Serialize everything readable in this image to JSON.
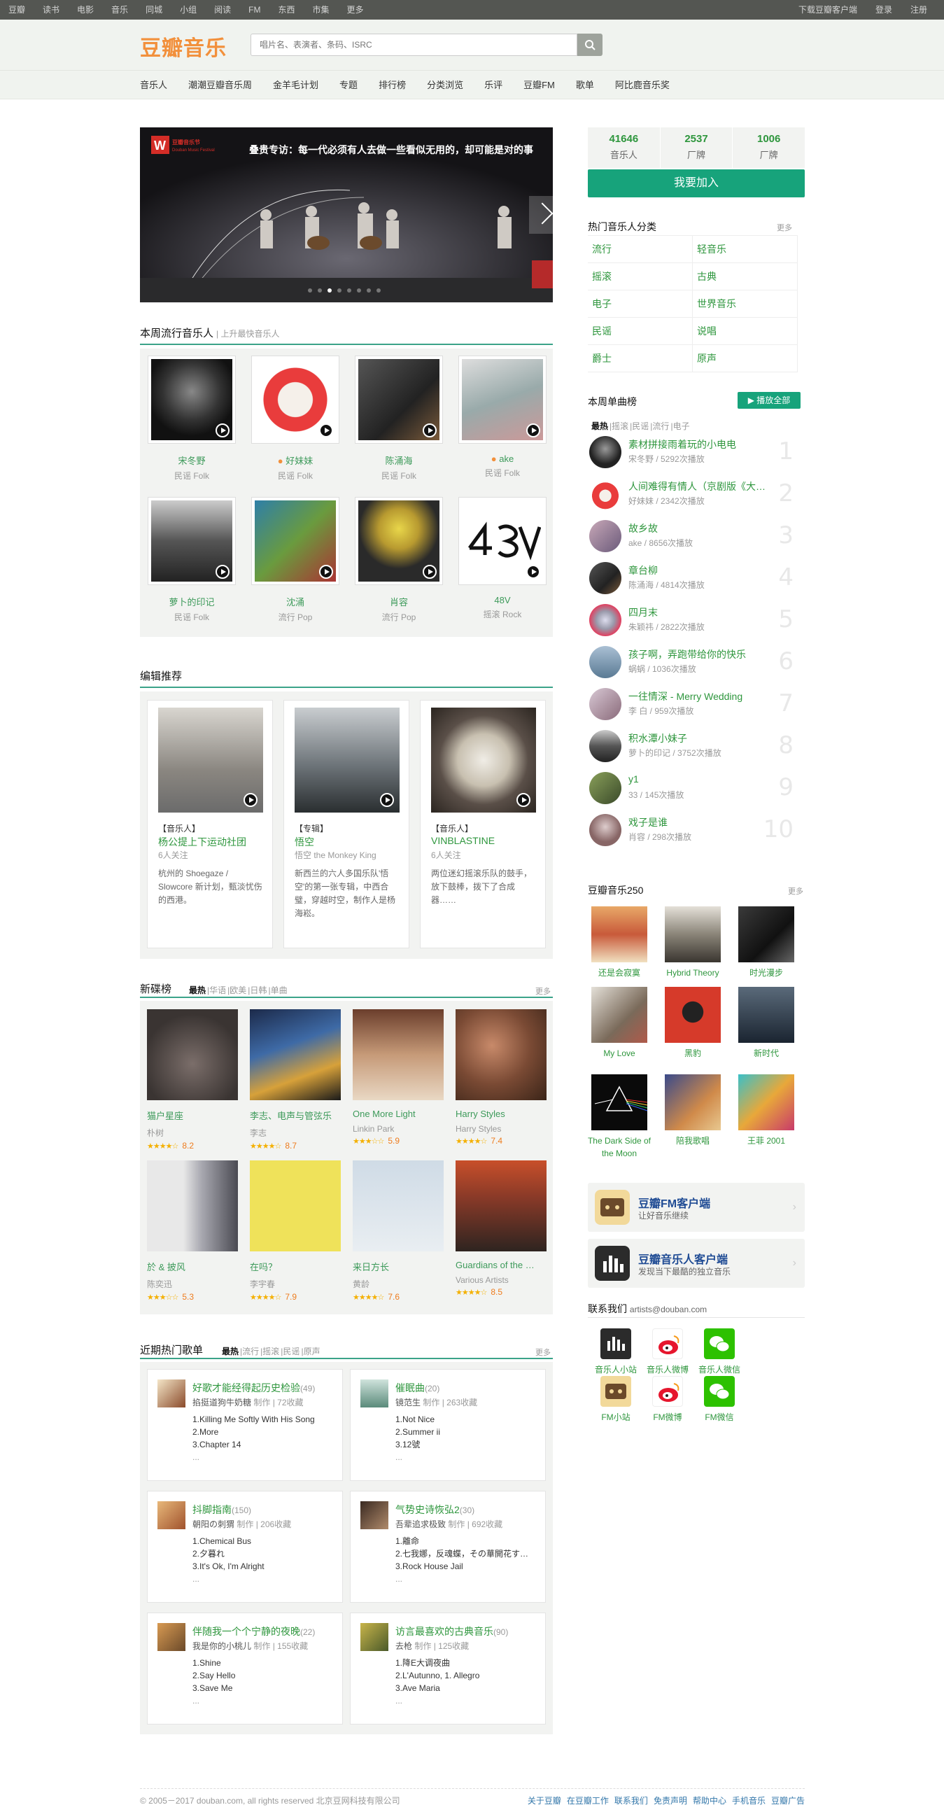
{
  "topnav": {
    "left": [
      "豆瓣",
      "读书",
      "电影",
      "音乐",
      "同城",
      "小组",
      "阅读",
      "FM",
      "东西",
      "市集",
      "更多"
    ],
    "right": [
      "下载豆瓣客户端",
      "登录",
      "注册"
    ]
  },
  "logo": "豆瓣音乐",
  "search": {
    "placeholder": "唱片名、表演者、条码、ISRC"
  },
  "subnav": [
    "音乐人",
    "潮潮豆瓣音乐周",
    "金羊毛计划",
    "专题",
    "排行榜",
    "分类浏览",
    "乐评",
    "豆瓣FM",
    "歌单",
    "阿比鹿音乐奖"
  ],
  "banner": {
    "text": "叠贵专访：每一代必须有人去做一些看似无用的，却可能是对的事",
    "logo_text": "Douban Music Festival"
  },
  "popular": {
    "title": "本周流行音乐人",
    "sub": "| 上升最快音乐人",
    "items": [
      {
        "name": "宋冬野",
        "genre": "民谣 Folk"
      },
      {
        "name": "好妹妹",
        "genre": "民谣 Folk"
      },
      {
        "name": "陈涌海",
        "genre": "民谣 Folk"
      },
      {
        "name": "ake",
        "genre": "民谣 Folk"
      },
      {
        "name": "萝卜的印记",
        "genre": "民谣 Folk"
      },
      {
        "name": "沈涌",
        "genre": "流行 Pop"
      },
      {
        "name": "肖容",
        "genre": "流行 Pop"
      },
      {
        "name": "48V",
        "genre": "摇滚 Rock"
      }
    ]
  },
  "editor": {
    "title": "编辑推荐",
    "items": [
      {
        "tag": "【音乐人】",
        "title": "杨公提上下运动社团",
        "follow": "6人关注",
        "desc": "杭州的 Shoegaze / Slowcore 新计划，甄淡忧伤的西港。"
      },
      {
        "tag": "【专辑】",
        "title": "悟空",
        "follow": "悟空 the Monkey King",
        "desc": "新西兰的六人多国乐队'悟空'的第一张专辑，中西合璧，穿越时空，制作人是杨海崧。"
      },
      {
        "tag": "【音乐人】",
        "title": "VINBLASTINE",
        "follow": "6人关注",
        "desc": "两位迷幻摇滚乐队的鼓手，放下鼓棒，拨下了合成器……"
      }
    ]
  },
  "newalbums": {
    "title": "新碟榜",
    "tabs": [
      "最热",
      "华语",
      "欧美",
      "日韩",
      "单曲"
    ],
    "more": "更多",
    "items": [
      {
        "name": "猫户星座",
        "artist": "朴树",
        "stars": "★★★★☆",
        "score": "8.2"
      },
      {
        "name": "李志、电声与管弦乐",
        "artist": "李志",
        "stars": "★★★★☆",
        "score": "8.7"
      },
      {
        "name": "One More Light",
        "artist": "Linkin Park",
        "stars": "★★★☆☆",
        "score": "5.9"
      },
      {
        "name": "Harry Styles",
        "artist": "Harry Styles",
        "stars": "★★★★☆",
        "score": "7.4"
      },
      {
        "name": "於 & 披风",
        "artist": "陈奕迅",
        "stars": "★★★☆☆",
        "score": "5.3"
      },
      {
        "name": "在吗？",
        "artist": "李宇春",
        "stars": "★★★★☆",
        "score": "7.9"
      },
      {
        "name": "来日方长",
        "artist": "黄龄",
        "stars": "★★★★☆",
        "score": "7.6"
      },
      {
        "name": "Guardians of the …",
        "artist": "Various Artists",
        "stars": "★★★★☆",
        "score": "8.5"
      }
    ]
  },
  "playlists": {
    "title": "近期热门歌单",
    "tabs": [
      "最热",
      "流行",
      "摇滚",
      "民谣",
      "原声"
    ],
    "more": "更多",
    "items": [
      {
        "title": "好歌才能经得起历史检验",
        "count": "(49)",
        "author": "掐挺道狗牛奶糖",
        "meta": "制作 | 72收藏",
        "songs": [
          "1.Killing Me Softly With His Song",
          "2.More",
          "3.Chapter 14",
          "..."
        ]
      },
      {
        "title": "催眠曲",
        "count": "(20)",
        "author": "镜范生",
        "meta": "制作 | 263收藏",
        "songs": [
          "1.Not Nice",
          "2.Summer ii",
          "3.12號",
          "..."
        ]
      },
      {
        "title": "抖脚指南",
        "count": "(150)",
        "author": "朝阳の刺猬",
        "meta": "制作 | 206收藏",
        "songs": [
          "1.Chemical Bus",
          "2.夕暮れ",
          "3.It's Ok, I'm Alright",
          "..."
        ]
      },
      {
        "title": "气势史诗恢弘2",
        "count": "(30)",
        "author": "吾辈追求极致",
        "meta": "制作 | 692收藏",
        "songs": [
          "1.離命",
          "2.七我娜，反魂蝶，その華開花す…",
          "3.Rock House Jail",
          "..."
        ]
      },
      {
        "title": "伴随我一个个宁静的夜晚",
        "count": "(22)",
        "author": "我是你的小桃儿",
        "meta": "制作 | 155收藏",
        "songs": [
          "1.Shine",
          "2.Say Hello",
          "3.Save Me",
          "..."
        ]
      },
      {
        "title": "访言最喜欢的古典音乐",
        "count": "(90)",
        "author": "去枪",
        "meta": "制作 | 125收藏",
        "songs": [
          "1.降E大调夜曲",
          "2.L'Autunno, 1. Allegro",
          "3.Ave Maria",
          "..."
        ]
      }
    ]
  },
  "stats": [
    {
      "num": "41646",
      "label": "音乐人"
    },
    {
      "num": "2537",
      "label": "厂牌"
    },
    {
      "num": "1006",
      "label": "厂牌"
    }
  ],
  "join": "我要加入",
  "categories": {
    "title": "热门音乐人分类",
    "more": "更多",
    "rows": [
      [
        "流行",
        "轻音乐"
      ],
      [
        "摇滚",
        "古典"
      ],
      [
        "电子",
        "世界音乐"
      ],
      [
        "民谣",
        "说唱"
      ],
      [
        "爵士",
        "原声"
      ]
    ]
  },
  "weekly": {
    "title": "本周单曲榜",
    "playall": "播放全部",
    "tabs": [
      "最热",
      "摇滚",
      "民谣",
      "流行",
      "电子"
    ],
    "items": [
      {
        "name": "素材拼接雨着玩的小电电",
        "info": "宋冬野 / 5292次播放",
        "rank": "1"
      },
      {
        "name": "人间难得有情人（京剧版《大…",
        "info": "好妹妹 / 2342次播放",
        "rank": "2"
      },
      {
        "name": "故乡故",
        "info": "ake / 8656次播放",
        "rank": "3"
      },
      {
        "name": "章台柳",
        "info": "陈涌海 / 4814次播放",
        "rank": "4"
      },
      {
        "name": "四月末",
        "info": "朱颖祎 / 2822次播放",
        "rank": "5"
      },
      {
        "name": "孩子啊，弄跑带给你的快乐",
        "info": "蜗蜗 / 1036次播放",
        "rank": "6"
      },
      {
        "name": "一往情深 - Merry Wedding",
        "info": "李 白 / 959次播放",
        "rank": "7"
      },
      {
        "name": "积水潭小妹子",
        "info": "萝卜的印记 / 3752次播放",
        "rank": "8"
      },
      {
        "name": "y1",
        "info": "33 / 145次播放",
        "rank": "9"
      },
      {
        "name": "戏子是谁",
        "info": "肖容 / 298次播放",
        "rank": "10"
      }
    ]
  },
  "top250": {
    "title": "豆瓣音乐250",
    "more": "更多",
    "items": [
      "还是会寂寞",
      "Hybrid Theory",
      "时光漫步",
      "My Love",
      "黑豹",
      "新时代",
      "The Dark Side of the Moon",
      "陪我歌唱",
      "王菲 2001"
    ]
  },
  "apps": [
    {
      "title": "豆瓣FM客户端",
      "sub": "让好音乐继续"
    },
    {
      "title": "豆瓣音乐人客户端",
      "sub": "发现当下最酷的独立音乐"
    }
  ],
  "contact": {
    "title": "联系我们",
    "email": "artists@douban.com",
    "items": [
      "音乐人小站",
      "音乐人微博",
      "音乐人微信",
      "FM小站",
      "FM微博",
      "FM微信"
    ]
  },
  "footer": {
    "copy": "© 2005－2017 douban.com, all rights reserved 北京豆网科技有限公司",
    "links": [
      "关于豆瓣",
      "在豆瓣工作",
      "联系我们",
      "免责声明",
      "帮助中心",
      "手机音乐",
      "豆瓣广告"
    ]
  },
  "colors": {
    "green": "#2e963d",
    "accent": "#17a37b",
    "orange": "#f2903c",
    "topbar": "#545652"
  }
}
